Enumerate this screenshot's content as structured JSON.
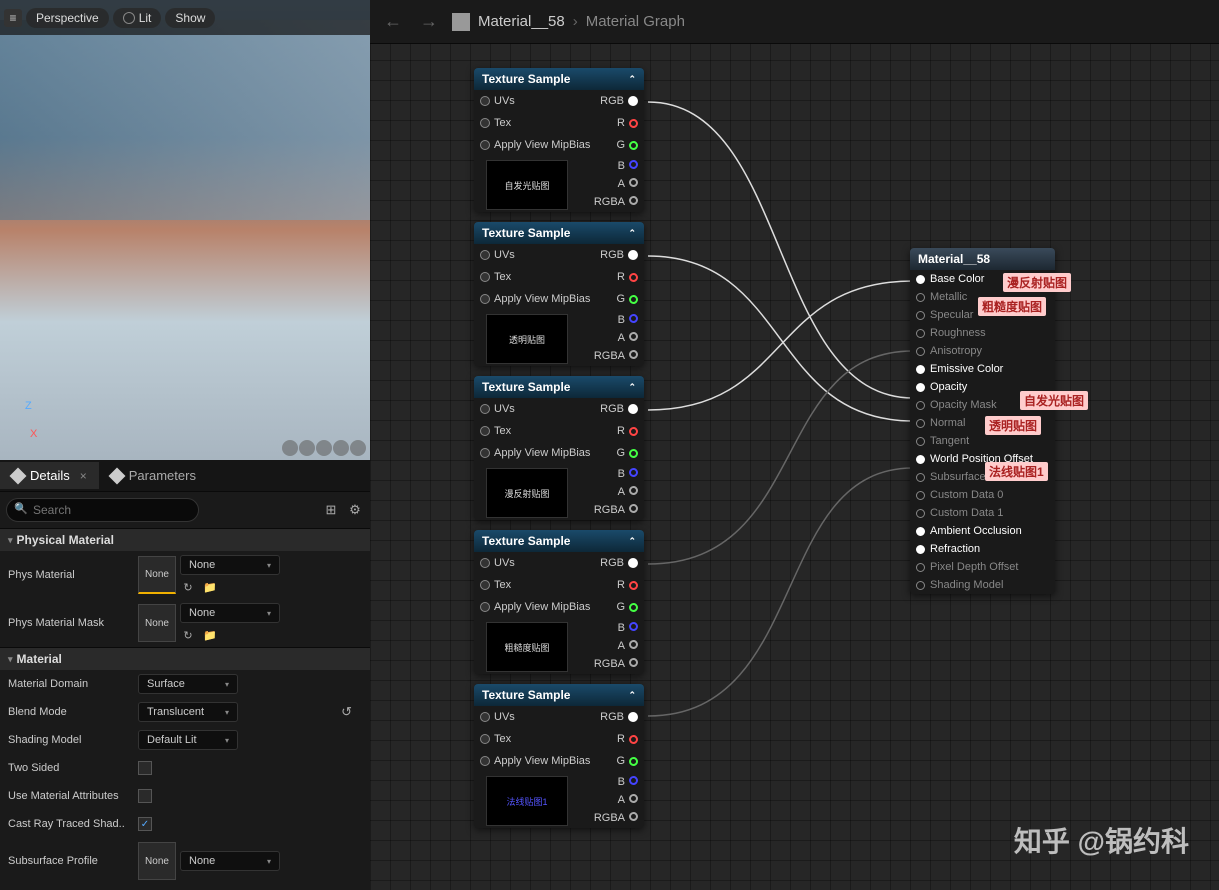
{
  "topbar": {
    "perspective": "Perspective",
    "lit": "Lit",
    "show": "Show"
  },
  "axis": {
    "z": "Z",
    "x": "X"
  },
  "tabs": {
    "details": "Details",
    "parameters": "Parameters"
  },
  "search": {
    "placeholder": "Search"
  },
  "sections": {
    "physical": "Physical Material",
    "material": "Material"
  },
  "props": {
    "physMaterial": "Phys Material",
    "physMaterialMask": "Phys Material Mask",
    "materialDomain": "Material Domain",
    "blendMode": "Blend Mode",
    "shadingModel": "Shading Model",
    "twoSided": "Two Sided",
    "useMatAttr": "Use Material Attributes",
    "castRay": "Cast Ray Traced Shad..",
    "subsurface": "Subsurface Profile"
  },
  "values": {
    "none": "None",
    "surface": "Surface",
    "translucent": "Translucent",
    "defaultLit": "Default Lit"
  },
  "breadcrumb": {
    "material": "Material__58",
    "graph": "Material Graph"
  },
  "textureSample": {
    "title": "Texture Sample",
    "uvs": "UVs",
    "tex": "Tex",
    "mipbias": "Apply View MipBias",
    "rgb": "RGB",
    "r": "R",
    "g": "G",
    "b": "B",
    "a": "A",
    "rgba": "RGBA"
  },
  "previews": [
    "自发光贴图",
    "透明贴图",
    "漫反射贴图",
    "粗糙度贴图",
    "法线贴图1"
  ],
  "matNode": {
    "title": "Material__58",
    "pins": [
      {
        "label": "Base Color",
        "active": true
      },
      {
        "label": "Metallic",
        "active": false
      },
      {
        "label": "Specular",
        "active": false
      },
      {
        "label": "Roughness",
        "active": false
      },
      {
        "label": "Anisotropy",
        "active": false
      },
      {
        "label": "Emissive Color",
        "active": true
      },
      {
        "label": "Opacity",
        "active": true
      },
      {
        "label": "Opacity Mask",
        "active": false
      },
      {
        "label": "Normal",
        "active": false
      },
      {
        "label": "Tangent",
        "active": false
      },
      {
        "label": "World Position Offset",
        "active": true
      },
      {
        "label": "Subsurface Color",
        "active": false
      },
      {
        "label": "Custom Data 0",
        "active": false
      },
      {
        "label": "Custom Data 1",
        "active": false
      },
      {
        "label": "Ambient Occlusion",
        "active": true
      },
      {
        "label": "Refraction",
        "active": true
      },
      {
        "label": "Pixel Depth Offset",
        "active": false
      },
      {
        "label": "Shading Model",
        "active": false
      }
    ]
  },
  "annotations": {
    "diffuse": "漫反射贴图",
    "roughness": "粗糙度贴图",
    "emissive": "自发光贴图",
    "opacity": "透明贴图",
    "normal": "法线贴图1"
  },
  "watermark": "知乎 @锅约科"
}
